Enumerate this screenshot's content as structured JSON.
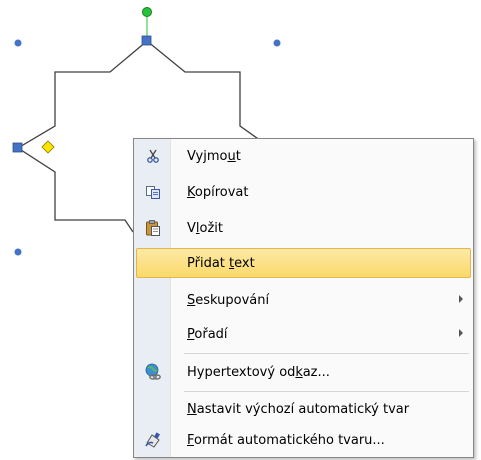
{
  "context_menu": {
    "items": [
      {
        "icon": "scissors-icon",
        "pre": "Vyjmo",
        "key": "u",
        "post": "t"
      },
      {
        "icon": "copy-icon",
        "pre": "",
        "key": "K",
        "post": "opírovat"
      },
      {
        "icon": "paste-icon",
        "pre": "V",
        "key": "l",
        "post": "ožit"
      },
      {
        "icon": "",
        "pre": "Přidat ",
        "key": "t",
        "post": "ext"
      },
      {
        "icon": "",
        "pre": "",
        "key": "S",
        "post": "eskupování"
      },
      {
        "icon": "",
        "pre": "",
        "key": "P",
        "post": "ořadí"
      },
      {
        "icon": "hyperlink-icon",
        "pre": "Hypertextový od",
        "key": "k",
        "post": "az..."
      },
      {
        "icon": "",
        "pre": "",
        "key": "N",
        "post": "astavit výchozí automatický tvar"
      },
      {
        "icon": "format-shape-icon",
        "pre": "",
        "key": "F",
        "post": "ormát automatického tvaru..."
      }
    ],
    "highlighted_index": 3
  },
  "colors": {
    "shape_outline": "#404040",
    "handle_blue": "#4472c4",
    "rotate_handle": "#29c23a",
    "adjust_handle": "#ffe500",
    "highlight": "#fbd96a"
  }
}
